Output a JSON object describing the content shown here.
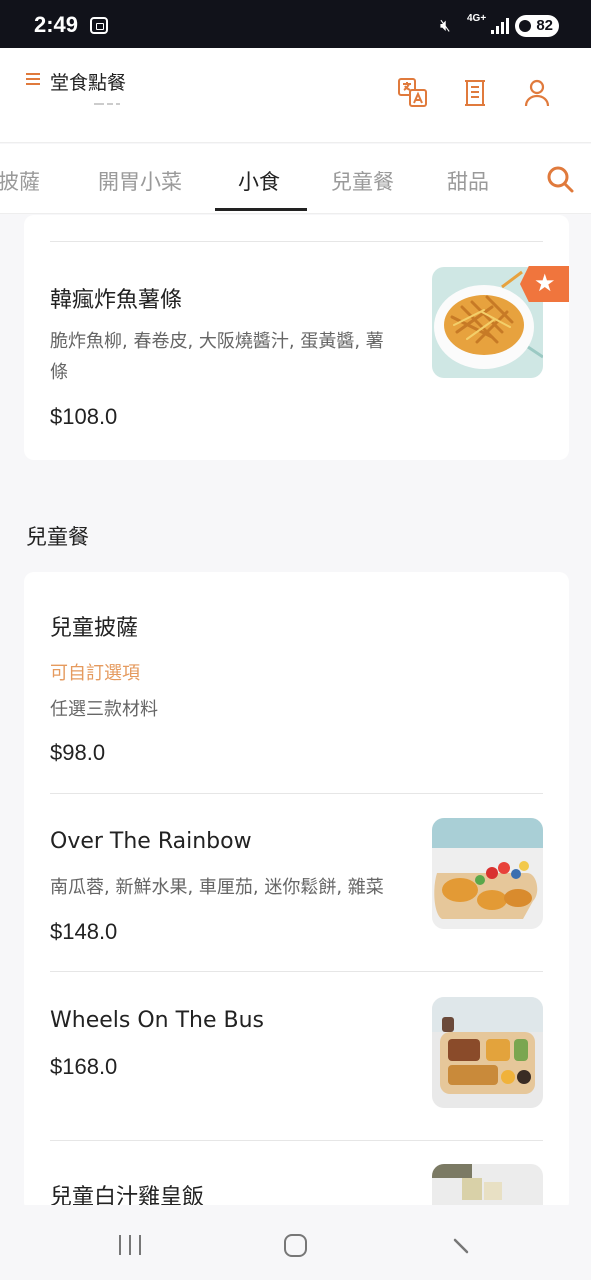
{
  "status_bar": {
    "time": "2:49",
    "network": "4G+",
    "battery": "82"
  },
  "header": {
    "title": "堂食點餐",
    "icons": [
      "menu-icon",
      "translate-icon",
      "receipt-icon",
      "account-icon"
    ]
  },
  "tabs": [
    {
      "label": "披薩",
      "active": false
    },
    {
      "label": "開胃小菜",
      "active": false
    },
    {
      "label": "小食",
      "active": true
    },
    {
      "label": "兒童餐",
      "active": false
    },
    {
      "label": "甜品",
      "active": false
    }
  ],
  "sections": {
    "snacks": {
      "items": [
        {
          "name": "韓瘋炸魚薯條",
          "description": "脆炸魚柳, 春卷皮, 大阪燒醬汁, 蛋黃醬, 薯條",
          "price": "$108.0",
          "featured": true
        }
      ]
    },
    "kids": {
      "title": "兒童餐",
      "items": [
        {
          "name": "兒童披薩",
          "custom_label": "可自訂選項",
          "description": "任選三款材料",
          "price": "$98.0"
        },
        {
          "name": "Over The Rainbow",
          "description": "南瓜蓉, 新鮮水果, 車厘茄, 迷你鬆餅, 雜菜",
          "price": "$148.0"
        },
        {
          "name": "Wheels On The Bus",
          "price": "$168.0"
        },
        {
          "name": "兒童白汁雞皇飯"
        }
      ]
    }
  },
  "colors": {
    "accent": "#e07a3c",
    "custom_label": "#e59a5e",
    "badge": "#f0753d"
  }
}
